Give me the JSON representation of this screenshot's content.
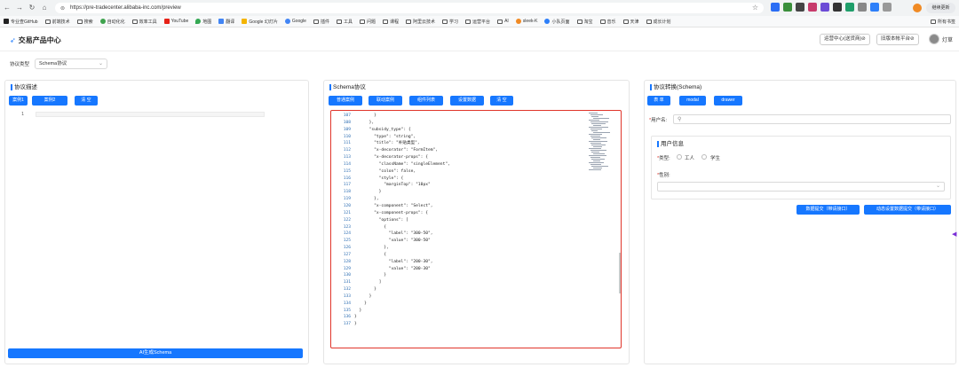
{
  "browser": {
    "url": "https://pre-tradecenter.alibaba-inc.com/preview",
    "profile_label": "继续更新",
    "bookmarks": [
      "专业查GitHub",
      "前端技术",
      "搜索",
      "自动化化",
      "效率工具",
      "YouTube",
      "地图",
      "翻译",
      "Google 幻灯片",
      "Google",
      "插件",
      "工具",
      "问题",
      "课程",
      "阿里云技术",
      "学习",
      "运营平台",
      "AI",
      "sleek-K",
      "小队页面",
      "淘宝",
      "音乐",
      "天津",
      "成长计划"
    ],
    "bookmarks_right": "所有书签"
  },
  "header": {
    "logo_text": "交易产品中心",
    "btn_ops_center": "运营中心(送货商)⊘",
    "btn_old_platform": "旧版本帐平台⊘",
    "user_name": "灯草"
  },
  "proto": {
    "label": "协议类型",
    "select_value": "Schema协议"
  },
  "left_panel": {
    "title": "协议描述",
    "btn_example1": "案例1",
    "btn_example2": "案例2",
    "btn_clear": "清 空",
    "line_number": "1",
    "generate_button": "AI生成Schema"
  },
  "middle_panel": {
    "title": "Schema协议",
    "btn_common": "普通案例",
    "btn_linkage": "联动案例",
    "btn_component_list": "组件列表",
    "btn_data_set": "设置数据",
    "btn_clear": "清 空",
    "line_numbers": [
      "107",
      "108",
      "109",
      "110",
      "111",
      "112",
      "113",
      "114",
      "115",
      "116",
      "117",
      "118",
      "119",
      "120",
      "121",
      "122",
      "123",
      "124",
      "125",
      "126",
      "127",
      "128",
      "129",
      "130",
      "131",
      "132",
      "133",
      "134",
      "135",
      "136",
      "137"
    ],
    "code": "        }\n      },\n      \"subsidy_type\": {\n        \"type\": \"string\",\n        \"title\": \"补贴类型\",\n        \"x-decorator\": \"FormItem\",\n        \"x-decorator-props\": {\n          \"className\": \"singleElement\",\n          \"colon\": false,\n          \"style\": {\n            \"marginTop\": \"10px\"\n          }\n        },\n        \"x-component\": \"Select\",\n        \"x-component-props\": {\n          \"options\": [\n            {\n              \"label\": \"300-50\",\n              \"value\": \"300-50\"\n            },\n            {\n              \"label\": \"200-30\",\n              \"value\": \"200-30\"\n            }\n          ]\n        }\n      }\n    }\n  }\n}\n}"
  },
  "right_panel": {
    "title": "协议转换(Schema)",
    "btn_form": "表 单",
    "btn_modal": "modal",
    "btn_drawer": "drawer",
    "username_label": "用户名",
    "fieldset_title": "用户信息",
    "type_label": "类型",
    "radio_worker": "工人",
    "radio_student": "学生",
    "gender_label": "性别",
    "submit_btn": "数据提交（带请接口）",
    "dynamic_submit_btn": "动态设置数据提交（带请接口）"
  }
}
